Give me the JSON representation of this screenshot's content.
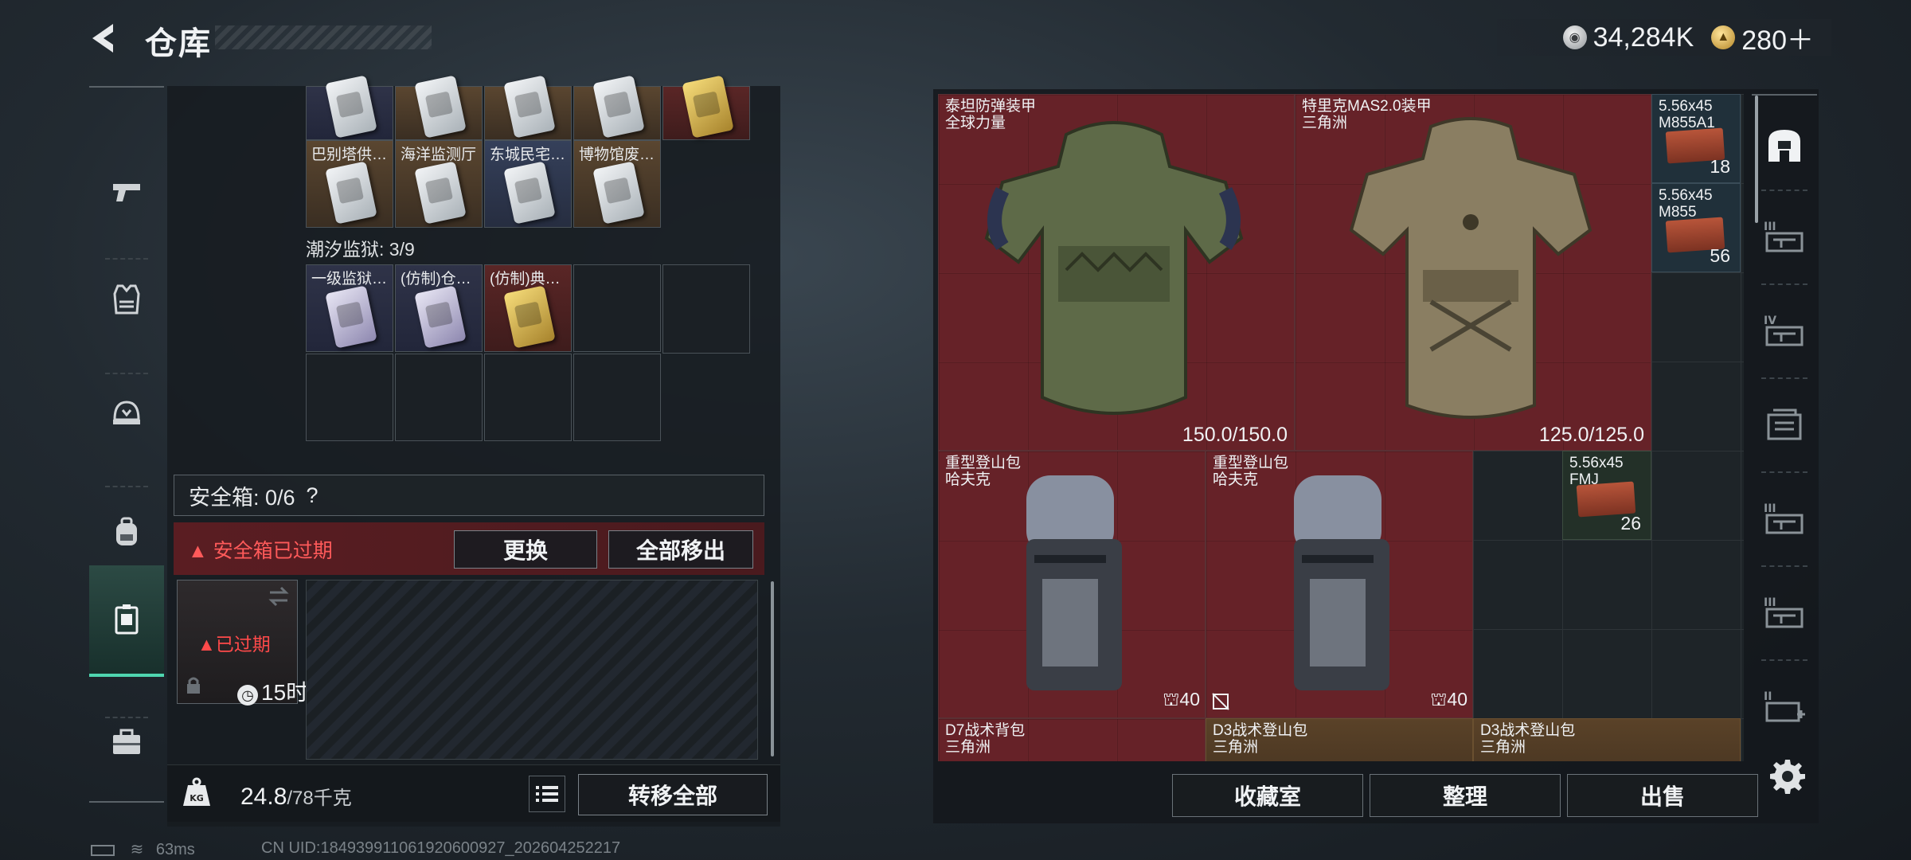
{
  "header": {
    "title": "仓库",
    "currency": [
      {
        "icon": "silver-coin-icon",
        "value": "34,284K"
      },
      {
        "icon": "gold-coin-icon",
        "value": "280＋"
      }
    ]
  },
  "left_nav": [
    {
      "icon": "pistol-icon",
      "active": false
    },
    {
      "icon": "vest-icon",
      "active": false
    },
    {
      "icon": "helmet-icon",
      "active": false
    },
    {
      "icon": "backpack-icon",
      "active": false
    },
    {
      "icon": "safebox-icon",
      "active": true
    },
    {
      "icon": "toolbox-icon",
      "active": false
    }
  ],
  "cards": {
    "row_top_labels": [
      "巴别塔供…",
      "海洋监测厅",
      "东城民宅…",
      "博物馆废…"
    ],
    "section_label": "潮汐监狱: 3/9",
    "prison_labels": [
      "一级监狱…",
      "(仿制)仓…",
      "(仿制)典…"
    ]
  },
  "safebox": {
    "label": "安全箱: 0/6",
    "help": "?",
    "expired_warning": "安全箱已过期",
    "replace_button": "更换",
    "remove_all_button": "全部移出",
    "slot_status": "已过期",
    "slot_time": "15时"
  },
  "footer": {
    "weight_value": "24.8",
    "weight_max": "/78千克",
    "weight_icon_text": "KG",
    "transfer_all_button": "转移全部",
    "ping": "63ms",
    "uid": "CN UID:184939911061920600927_202604252217"
  },
  "stash": {
    "items": [
      {
        "name": "泰坦防弹装甲",
        "sub": "全球力量",
        "durability": "150.0/150.0"
      },
      {
        "name": "特里克MAS2.0装甲",
        "sub": "三角洲",
        "durability": "125.0/125.0"
      },
      {
        "name": "重型登山包",
        "sub": "哈夫克",
        "capacity": "40"
      },
      {
        "name": "重型登山包",
        "sub": "哈夫克",
        "capacity": "40"
      },
      {
        "name": "D7战术背包",
        "sub": "三角洲"
      },
      {
        "name": "D3战术登山包",
        "sub": "三角洲"
      },
      {
        "name": "D3战术登山包",
        "sub": "三角洲"
      }
    ],
    "ammo": [
      {
        "name": "5.56x45",
        "sub": "M855A1",
        "count": "18"
      },
      {
        "name": "5.56x45",
        "sub": "M855",
        "count": "56"
      },
      {
        "name": "5.56x45",
        "sub": "FMJ",
        "count": "26"
      }
    ],
    "buttons": {
      "collection": "收藏室",
      "sort": "整理",
      "sell": "出售"
    }
  },
  "right_nav": [
    {
      "icon": "shelter-icon",
      "active": true
    },
    {
      "icon": "tier-3-weapon-case-icon",
      "active": false
    },
    {
      "icon": "tier-4-weapon-case-icon",
      "active": false
    },
    {
      "icon": "storage-box-icon",
      "active": false
    },
    {
      "icon": "tier-3-weapon-case-icon",
      "active": false
    },
    {
      "icon": "tier-3-weapon-case-icon",
      "active": false
    },
    {
      "icon": "tier-2-weapon-case-add-icon",
      "active": false
    }
  ]
}
